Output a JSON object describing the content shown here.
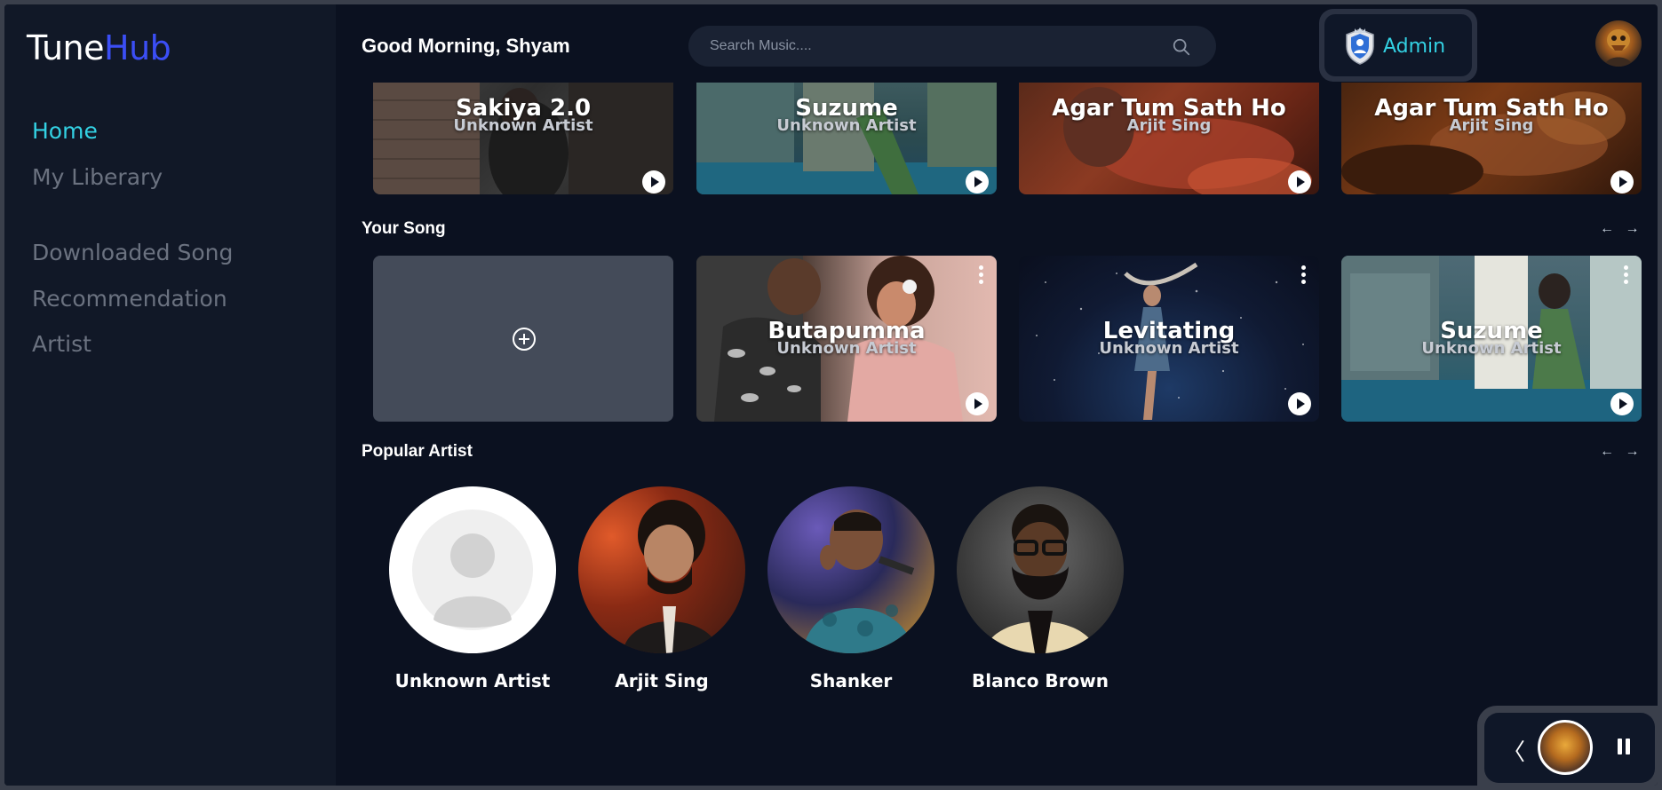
{
  "logo": {
    "part1": "Tune",
    "part2": "Hub"
  },
  "sidebar": {
    "items": [
      {
        "label": "Home",
        "active": true
      },
      {
        "label": "My Liberary",
        "active": false
      },
      {
        "label": "Downloaded Song",
        "active": false
      },
      {
        "label": "Recommendation",
        "active": false
      },
      {
        "label": "Artist",
        "active": false
      }
    ]
  },
  "header": {
    "greeting": "Good Morning, Shyam",
    "search_placeholder": "Search Music....",
    "admin_label": "Admin"
  },
  "top_row": [
    {
      "title": "Sakiya 2.0",
      "artist": "Unknown Artist"
    },
    {
      "title": "Suzume",
      "artist": "Unknown Artist"
    },
    {
      "title": "Agar Tum Sath Ho",
      "artist": "Arjit Sing"
    },
    {
      "title": "Agar Tum Sath Ho",
      "artist": "Arjit Sing"
    }
  ],
  "your_song": {
    "title": "Your Song",
    "arrows": "← →",
    "songs": [
      {
        "title": "Butapumma",
        "artist": "Unknown Artist"
      },
      {
        "title": "Levitating",
        "artist": "Unknown Artist"
      },
      {
        "title": "Suzume",
        "artist": "Unknown Artist"
      }
    ]
  },
  "popular_artist": {
    "title": "Popular Artist",
    "arrows": "← →",
    "artists": [
      {
        "name": "Unknown Artist"
      },
      {
        "name": "Arjit Sing"
      },
      {
        "name": "Shanker"
      },
      {
        "name": "Blanco Brown"
      }
    ]
  },
  "player": {
    "prev_glyph": "〈"
  },
  "colors": {
    "accent": "#33d1e3",
    "brand_blue": "#3b4ef5",
    "background": "#0b1120",
    "sidebar": "#111827"
  }
}
